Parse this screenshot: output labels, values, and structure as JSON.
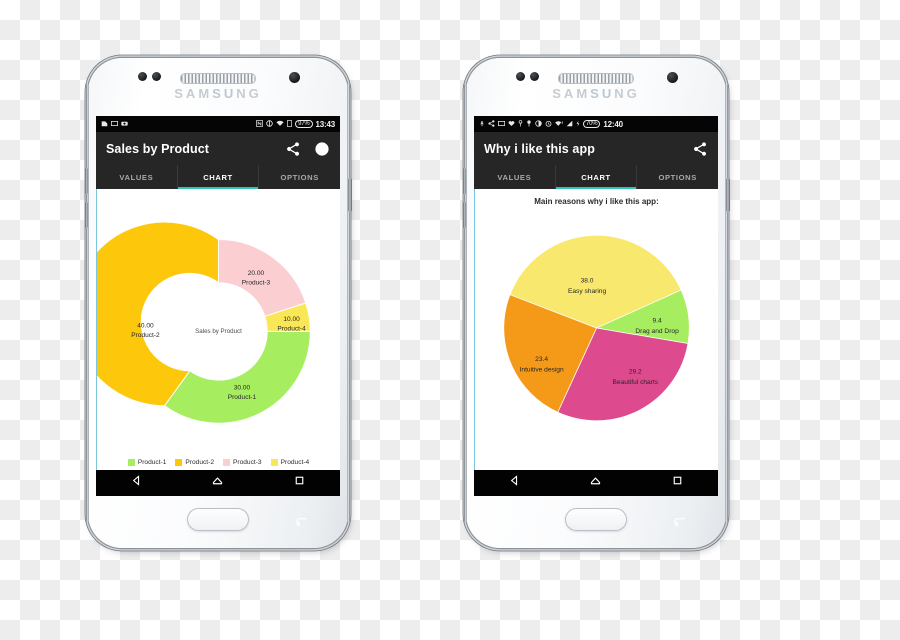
{
  "phones": [
    {
      "id": "left",
      "brand": "SAMSUNG",
      "statusbar": {
        "left_icons": [
          "sd-card-icon",
          "image-icon",
          "camera-icon"
        ],
        "right_icons": [
          "nfc-icon",
          "sync-icon",
          "wifi-icon",
          "sim-icon"
        ],
        "battery": "97%",
        "time": "13:43"
      },
      "appbar": {
        "title": "Sales by Product",
        "actions": [
          "share-icon",
          "check-circle-icon"
        ]
      },
      "tabs": [
        {
          "label": "VALUES",
          "active": false
        },
        {
          "label": "CHART",
          "active": true
        },
        {
          "label": "OPTIONS",
          "active": false
        }
      ],
      "navbar": [
        "back-icon",
        "home-icon",
        "recents-icon"
      ],
      "chart_data": {
        "type": "pie",
        "variant": "donut",
        "title": "Sales by Product",
        "center_label": "Sales by Product",
        "categories": [
          "Product-1",
          "Product-2",
          "Product-3",
          "Product-4"
        ],
        "values": [
          30.0,
          40.0,
          20.0,
          10.0
        ],
        "value_labels": [
          "30.00",
          "40.00",
          "20.00",
          "10.00"
        ],
        "colors": [
          "#a6ee5f",
          "#fdc70c",
          "#fbcfd2",
          "#fae755"
        ],
        "legend_position": "bottom",
        "total": 100.0,
        "slices": [
          {
            "label": "Product-1",
            "value": "30.00",
            "color": "#a6ee5f"
          },
          {
            "label": "Product-2",
            "value": "40.00",
            "color": "#fdc70c"
          },
          {
            "label": "Product-3",
            "value": "20.00",
            "color": "#fbcfd2"
          },
          {
            "label": "Product-4",
            "value": "10.00",
            "color": "#fae755"
          }
        ]
      }
    },
    {
      "id": "right",
      "brand": "SAMSUNG",
      "statusbar": {
        "left_icons": [
          "usb-icon",
          "share-icon",
          "image-icon",
          "heart-icon",
          "key-icon",
          "pin-icon",
          "contrast-icon",
          "alarm-icon",
          "wifi-alert-icon",
          "signal-icon",
          "charging-icon"
        ],
        "right_icons": [],
        "battery": "70%",
        "time": "12:40"
      },
      "appbar": {
        "title": "Why i like this app",
        "actions": [
          "share-icon"
        ]
      },
      "tabs": [
        {
          "label": "VALUES",
          "active": false
        },
        {
          "label": "CHART",
          "active": true
        },
        {
          "label": "OPTIONS",
          "active": false
        }
      ],
      "navbar": [
        "back-icon",
        "home-icon",
        "recents-icon"
      ],
      "chart_data": {
        "type": "pie",
        "variant": "pie",
        "title": "Main reasons why i like this app:",
        "categories": [
          "Easy sharing",
          "Drag and Drop",
          "Beautiful charts",
          "Intuitive design"
        ],
        "values": [
          38.0,
          9.4,
          29.2,
          23.4
        ],
        "value_labels": [
          "38.0",
          "9.4",
          "29.2",
          "23.4"
        ],
        "colors": [
          "#f8e96e",
          "#a6ee5f",
          "#de4a8e",
          "#f59a18"
        ],
        "legend_position": "none",
        "total": 100.0,
        "slices": [
          {
            "label": "Easy sharing",
            "value": "38.0",
            "color": "#f8e96e"
          },
          {
            "label": "Drag and Drop",
            "value": "9.4",
            "color": "#a6ee5f"
          },
          {
            "label": "Beautiful charts",
            "value": "29.2",
            "color": "#de4a8e"
          },
          {
            "label": "Intuitive design",
            "value": "23.4",
            "color": "#f59a18"
          }
        ]
      }
    }
  ],
  "theme": {
    "appbar_bg": "#262626",
    "accent_teal": "#2ec4b6",
    "statusbar_bg": "#050505"
  }
}
